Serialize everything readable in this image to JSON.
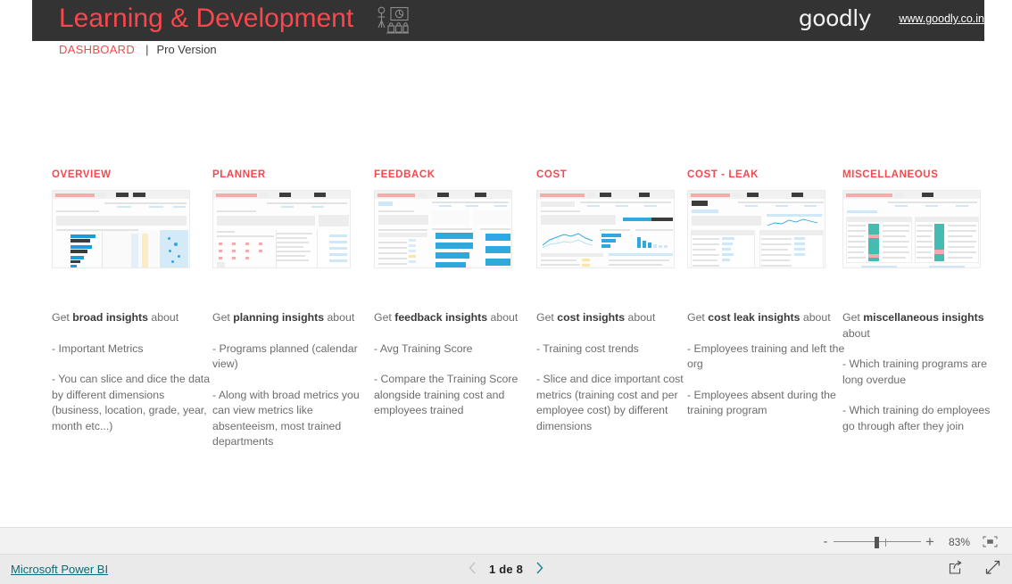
{
  "header": {
    "title": "Learning & Development",
    "icon": "training-presentation-icon",
    "brand": "goodly",
    "url": "www.goodly.co.in",
    "subtitle_main": "DASHBOARD",
    "subtitle_separator": "|",
    "subtitle_secondary": "Pro Version",
    "bar_color": "#333333",
    "accent_color": "#f8474d"
  },
  "cards": [
    {
      "title": "OVERVIEW",
      "thumbnail": "overview-report-thumbnail",
      "intro_prefix": "Get ",
      "intro_bold": "broad insights",
      "intro_suffix": " about",
      "bullets": [
        " - Important Metrics",
        " - You can slice and dice the data by different dimensions (business, location, grade, year, month etc...)"
      ]
    },
    {
      "title": "PLANNER",
      "thumbnail": "planner-report-thumbnail",
      "intro_prefix": "Get ",
      "intro_bold": "planning insights",
      "intro_suffix": " about",
      "bullets": [
        " - Programs planned (calendar view)",
        " - Along with broad metrics you can view metrics like absenteeism, most trained departments"
      ]
    },
    {
      "title": "FEEDBACK",
      "thumbnail": "feedback-report-thumbnail",
      "intro_prefix": "Get ",
      "intro_bold": "feedback insights",
      "intro_suffix": " about",
      "bullets": [
        " - Avg Training Score",
        " - Compare the Training Score alongside training cost and employees trained"
      ]
    },
    {
      "title": "COST",
      "thumbnail": "cost-report-thumbnail",
      "intro_prefix": "Get ",
      "intro_bold": "cost insights",
      "intro_suffix": " about",
      "bullets": [
        " - Training cost trends",
        " - Slice and dice important cost metrics (training cost and per employee cost) by different dimensions"
      ]
    },
    {
      "title": "COST - LEAK",
      "thumbnail": "cost-leak-report-thumbnail",
      "intro_prefix": "Get ",
      "intro_bold": "cost leak insights",
      "intro_suffix": " about",
      "bullets": [
        " - Employees training and left the org",
        " - Employees absent during the training program"
      ]
    },
    {
      "title": "MISCELLANEOUS",
      "thumbnail": "miscellaneous-report-thumbnail",
      "intro_prefix": "Get ",
      "intro_bold": "miscellaneous insights",
      "intro_suffix": " about",
      "bullets": [
        " - Which training programs are long overdue",
        " - Which training do employees go through after they join"
      ]
    }
  ],
  "zoombar": {
    "minus_label": "-",
    "plus_label": "+",
    "zoom_level": "83%",
    "fit_icon": "fit-to-page-icon"
  },
  "statusbar": {
    "powerbi_link": "Microsoft Power BI",
    "page_label": "1 de 8",
    "prev_icon": "chevron-left-icon",
    "next_icon": "chevron-right-icon",
    "share_icon": "share-icon",
    "fullscreen_icon": "fullscreen-icon",
    "link_color": "#0f6a77"
  }
}
